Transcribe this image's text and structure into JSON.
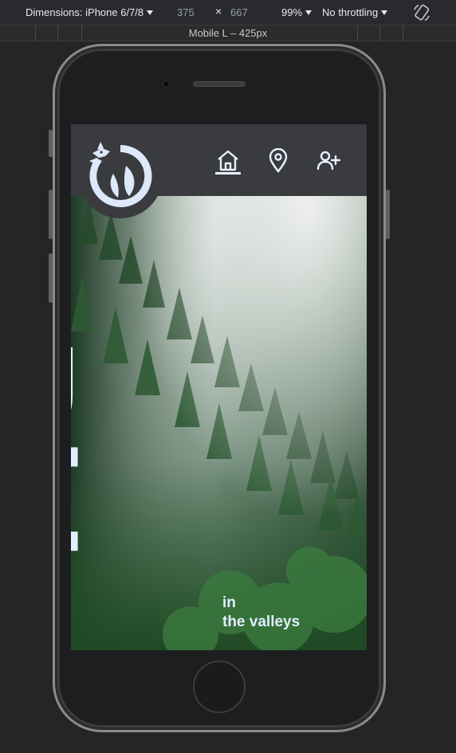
{
  "toolbar": {
    "dimensions_label": "Dimensions: iPhone 6/7/8",
    "width_value": "375",
    "times_glyph": "×",
    "height_value": "667",
    "zoom_label": "99%",
    "throttling_label": "No throttling",
    "rotate_icon": "rotate-icon"
  },
  "ruler": {
    "label": "Mobile L – 425px"
  },
  "site": {
    "logo_icon": "dragon-ring-icon",
    "nav": [
      {
        "name": "home",
        "icon": "home-icon",
        "active": true
      },
      {
        "name": "location",
        "icon": "location-pin-icon",
        "active": false
      },
      {
        "name": "add-user",
        "icon": "add-user-icon",
        "active": false
      }
    ],
    "hero_word": "Ride",
    "tagline_line1": "in",
    "tagline_line2": "the valleys"
  },
  "colors": {
    "header_bg": "#3a3b3f",
    "hero_text": "#e2eeff",
    "devtools_bg": "#292a2d"
  }
}
